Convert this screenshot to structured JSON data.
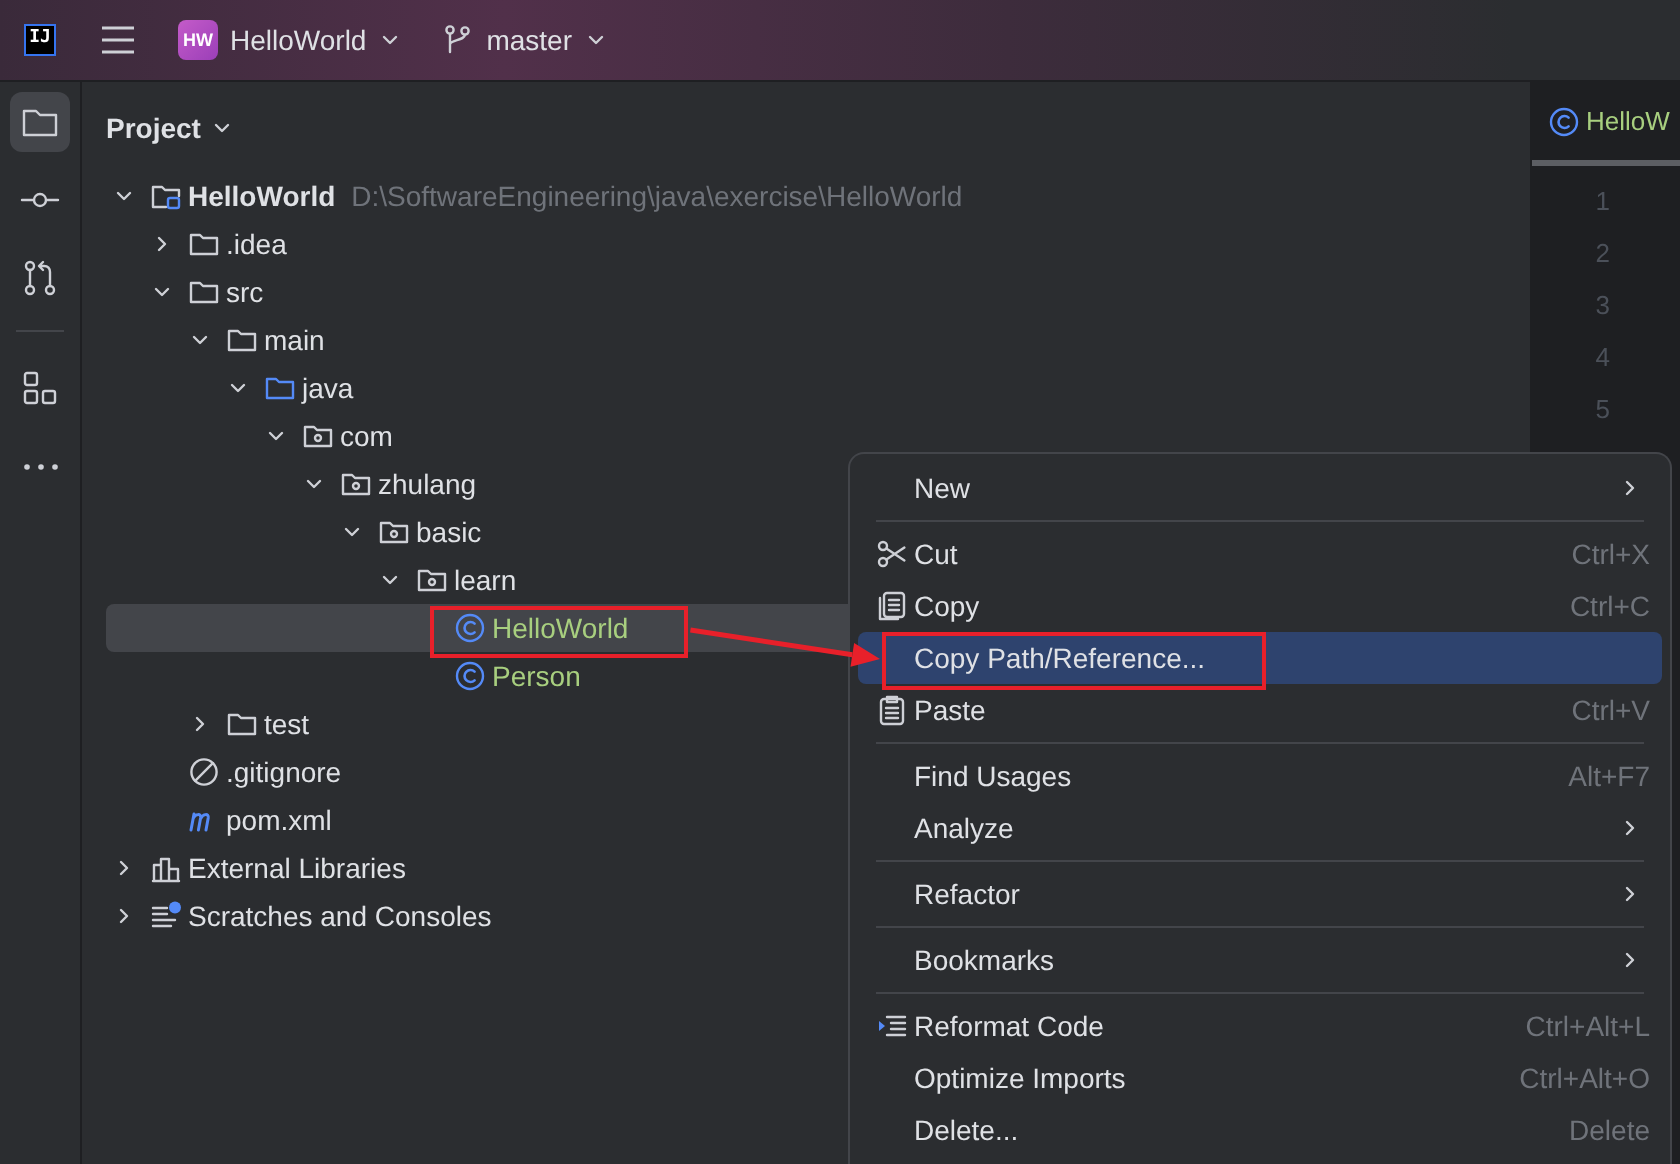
{
  "title_bar": {
    "logo": "IJ",
    "project_badge": "HW",
    "project": "HelloWorld",
    "branch": "master"
  },
  "tool_strip": [
    [
      {
        "kind": "project",
        "selected": true
      },
      {
        "kind": "commit",
        "selected": false
      },
      {
        "kind": "pull-requests",
        "selected": false
      }
    ],
    [
      {
        "kind": "structure",
        "selected": false
      },
      {
        "kind": "more",
        "selected": false
      }
    ]
  ],
  "project_panel": {
    "title": "Project",
    "tree": [
      {
        "label": "HelloWorld",
        "kind": "project",
        "path": "D:\\SoftwareEngineering\\java\\exercise\\HelloWorld",
        "expanded": true,
        "selected": false,
        "children": [
          {
            "label": ".idea",
            "kind": "folder",
            "expanded": false,
            "selected": false
          },
          {
            "label": "src",
            "kind": "folder",
            "expanded": true,
            "selected": false,
            "children": [
              {
                "label": "main",
                "kind": "folder",
                "expanded": true,
                "selected": false,
                "children": [
                  {
                    "label": "java",
                    "kind": "source-folder",
                    "expanded": true,
                    "selected": false,
                    "children": [
                      {
                        "label": "com",
                        "kind": "package",
                        "expanded": true,
                        "selected": false,
                        "children": [
                          {
                            "label": "zhulang",
                            "kind": "package",
                            "expanded": true,
                            "selected": false,
                            "children": [
                              {
                                "label": "basic",
                                "kind": "package",
                                "expanded": true,
                                "selected": false,
                                "children": [
                                  {
                                    "label": "learn",
                                    "kind": "package",
                                    "expanded": true,
                                    "selected": false,
                                    "children": [
                                      {
                                        "label": "HelloWorld",
                                        "kind": "class",
                                        "selected": true,
                                        "callout": true
                                      },
                                      {
                                        "label": "Person",
                                        "kind": "class",
                                        "selected": false
                                      }
                                    ]
                                  }
                                ]
                              }
                            ]
                          }
                        ]
                      }
                    ]
                  }
                ]
              },
              {
                "label": "test",
                "kind": "folder",
                "expanded": false,
                "selected": false
              }
            ]
          },
          {
            "label": ".gitignore",
            "kind": "gitignore",
            "selected": false
          },
          {
            "label": "pom.xml",
            "kind": "maven",
            "selected": false
          }
        ]
      },
      {
        "label": "External Libraries",
        "kind": "libraries",
        "expanded": false,
        "selected": false
      },
      {
        "label": "Scratches and Consoles",
        "kind": "scratches",
        "expanded": false,
        "selected": false
      }
    ]
  },
  "editor": {
    "tab": {
      "label": "HelloW",
      "kind": "class"
    },
    "line_numbers": [
      "1",
      "2",
      "3",
      "4",
      "5"
    ]
  },
  "context_menu": {
    "groups": [
      [
        {
          "label": "New",
          "kind": "plain",
          "submenu": true,
          "selected": false
        }
      ],
      [
        {
          "label": "Cut",
          "kind": "cut",
          "shortcut": "Ctrl+X",
          "submenu": false,
          "selected": false
        },
        {
          "label": "Copy",
          "kind": "copy",
          "shortcut": "Ctrl+C",
          "submenu": false,
          "selected": false
        },
        {
          "label": "Copy Path/Reference...",
          "kind": "plain",
          "submenu": false,
          "selected": true,
          "callout": true
        },
        {
          "label": "Paste",
          "kind": "paste",
          "shortcut": "Ctrl+V",
          "submenu": false,
          "selected": false
        }
      ],
      [
        {
          "label": "Find Usages",
          "kind": "plain",
          "shortcut": "Alt+F7",
          "submenu": false,
          "selected": false
        },
        {
          "label": "Analyze",
          "kind": "plain",
          "submenu": true,
          "selected": false
        }
      ],
      [
        {
          "label": "Refactor",
          "kind": "plain",
          "submenu": true,
          "selected": false
        }
      ],
      [
        {
          "label": "Bookmarks",
          "kind": "plain",
          "submenu": true,
          "selected": false
        }
      ],
      [
        {
          "label": "Reformat Code",
          "kind": "reformat",
          "shortcut": "Ctrl+Alt+L",
          "submenu": false,
          "selected": false
        },
        {
          "label": "Optimize Imports",
          "kind": "plain",
          "shortcut": "Ctrl+Alt+O",
          "submenu": false,
          "selected": false
        },
        {
          "label": "Delete...",
          "kind": "plain",
          "shortcut": "Delete",
          "submenu": false,
          "selected": false
        }
      ]
    ]
  }
}
